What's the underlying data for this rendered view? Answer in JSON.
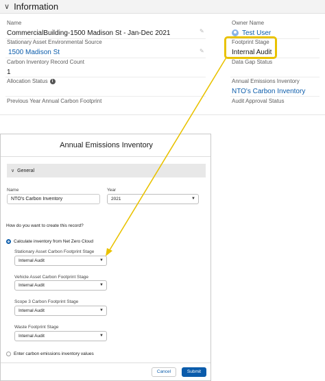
{
  "detail": {
    "section_title": "Information",
    "left": [
      {
        "label": "Name",
        "value": "CommercialBuilding-1500 Madison St - Jan-Dec 2021",
        "link": false
      },
      {
        "label": "Stationary Asset Environmental Source",
        "value": "1500 Madison St",
        "link": true
      },
      {
        "label": "Carbon Inventory Record Count",
        "value": "1",
        "link": false
      },
      {
        "label": "Allocation Status",
        "value": "",
        "link": false
      },
      {
        "label": "Previous Year Annual Carbon Footprint",
        "value": "",
        "link": false
      }
    ],
    "right": [
      {
        "label": "Owner Name",
        "value": "Test User",
        "link": true
      },
      {
        "label": "Footprint Stage",
        "value": "Internal Audit",
        "link": false
      },
      {
        "label": "Data Gap Status",
        "value": "",
        "link": false
      },
      {
        "label": "Annual Emissions Inventory",
        "value": "NTO's Carbon Inventory",
        "link": true
      },
      {
        "label": "Audit Approval Status",
        "value": "",
        "link": false
      }
    ]
  },
  "modal": {
    "title": "Annual Emissions Inventory",
    "section": "General",
    "name_label": "Name",
    "name_value": "NTO's Carbon Inventory",
    "year_label": "Year",
    "year_value": "2021",
    "question": "How do you want to create this record?",
    "option_calculate": "Calculate inventory from Net Zero Cloud",
    "stages": [
      {
        "label": "Stationary Asset Carbon Footprint Stage",
        "value": "Internal Audit"
      },
      {
        "label": "Vehicle Asset Carbon Footprint Stage",
        "value": "Internal Audit"
      },
      {
        "label": "Scope 3 Carbon Footprint Stage",
        "value": "Internal Audit"
      },
      {
        "label": "Waste Footprint Stage",
        "value": "Internal Audit"
      }
    ],
    "option_enter": "Enter carbon emissions inventory values",
    "cancel_label": "Cancel",
    "submit_label": "Submit"
  },
  "colors": {
    "link": "#0b5cab",
    "highlight": "#e9c200",
    "brand_button": "#0b5cab"
  }
}
